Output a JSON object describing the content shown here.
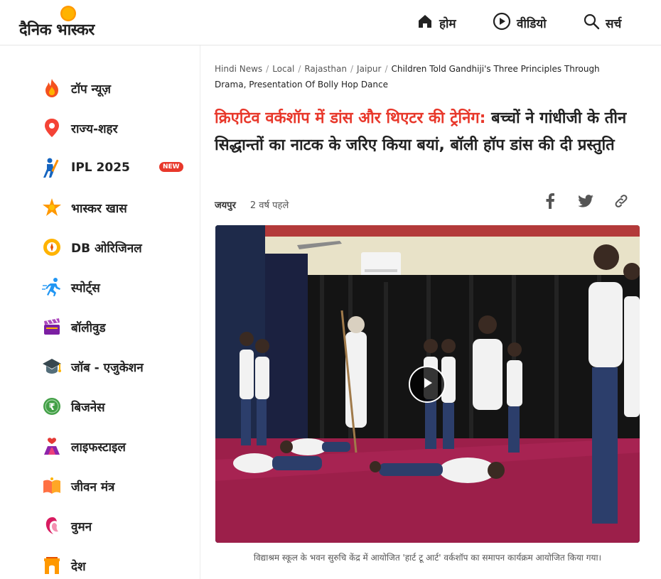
{
  "header": {
    "logo_text": "दैनिक भास्कर",
    "nav": [
      {
        "label": "होम",
        "icon": "home-icon"
      },
      {
        "label": "वीडियो",
        "icon": "play-circle-icon"
      },
      {
        "label": "सर्च",
        "icon": "search-icon"
      }
    ]
  },
  "sidebar": {
    "items": [
      {
        "label": "टॉप न्यूज़",
        "icon": "flame-icon"
      },
      {
        "label": "राज्य-शहर",
        "icon": "location-pin-icon"
      },
      {
        "label": "IPL 2025",
        "icon": "cricket-batsman-icon",
        "badge": "NEW"
      },
      {
        "label": "भास्कर खास",
        "icon": "star-burst-icon"
      },
      {
        "label": "DB ओरिजिनल",
        "icon": "db-original-icon"
      },
      {
        "label": "स्पोर्ट्स",
        "icon": "running-icon"
      },
      {
        "label": "बॉलीवुड",
        "icon": "clapperboard-icon"
      },
      {
        "label": "जॉब - एजुकेशन",
        "icon": "graduation-cap-icon"
      },
      {
        "label": "बिजनेस",
        "icon": "rupee-coin-icon"
      },
      {
        "label": "लाइफस्टाइल",
        "icon": "lifestyle-icon"
      },
      {
        "label": "जीवन मंत्र",
        "icon": "book-icon"
      },
      {
        "label": "वुमन",
        "icon": "woman-icon"
      },
      {
        "label": "देश",
        "icon": "india-gate-icon"
      }
    ]
  },
  "article": {
    "breadcrumb": [
      "Hindi News",
      "Local",
      "Rajasthan",
      "Jaipur"
    ],
    "breadcrumb_current": "Children Told Gandhiji's Three Principles Through Drama, Presentation Of Bolly Hop Dance",
    "headline_highlight": "क्रिएटिव वर्कशॉप में डांस और थिएटर की ट्रेनिंग:",
    "headline_rest": " बच्चों ने गांधीजी के तीन सिद्धान्तों का नाटक के जरिए किया बयां, बॉली हॉप डांस की दी प्रस्तुति",
    "location": "जयपुर",
    "time": "2 वर्ष पहले",
    "share": [
      "facebook-icon",
      "twitter-icon",
      "link-icon"
    ],
    "caption": "विद्याश्रम स्कूल के भवन सुरुचि केंद्र में आयोजित 'हार्ट टू आर्ट' वर्कशॉप का समापन कार्यक्रम आयोजित किया गया।"
  },
  "colors": {
    "accent": "#e8382b",
    "logo_sun": "#ffb300",
    "text": "#222222"
  }
}
